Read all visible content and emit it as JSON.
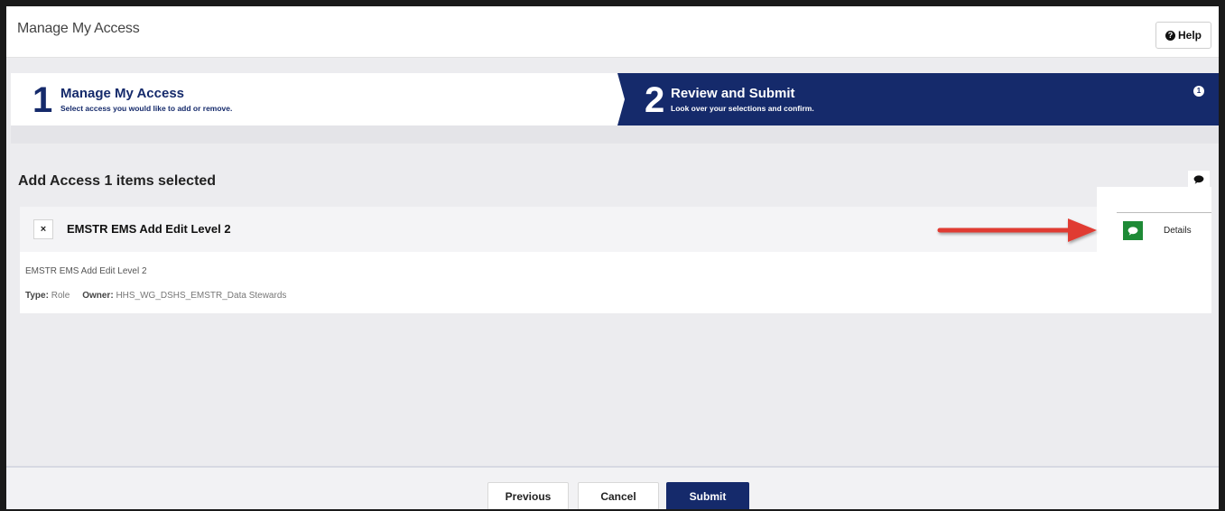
{
  "header": {
    "title": "Manage My Access",
    "help_label": "Help"
  },
  "steps": [
    {
      "number": "1",
      "title": "Manage My Access",
      "subtitle": "Select access you would like to add or remove."
    },
    {
      "number": "2",
      "title": "Review and Submit",
      "subtitle": "Look over your selections and confirm.",
      "badge": "1"
    }
  ],
  "section": {
    "title": "Add Access 1 items selected"
  },
  "item": {
    "remove_glyph": "×",
    "name": "EMSTR EMS Add Edit Level 2",
    "description": "EMSTR EMS Add Edit Level 2",
    "type_label": "Type:",
    "type_value": "Role",
    "owner_label": "Owner:",
    "owner_value": "HHS_WG_DSHS_EMSTR_Data Stewards"
  },
  "details": {
    "label": "Details"
  },
  "footer": {
    "previous_label": "Previous",
    "cancel_label": "Cancel",
    "submit_label": "Submit"
  },
  "colors": {
    "brand_navy": "#152a6b",
    "success_green": "#1e8a36",
    "annotation_red": "#e03a33"
  },
  "icons": [
    "help-icon",
    "comment-icon",
    "close-icon",
    "arrow-right-icon"
  ]
}
